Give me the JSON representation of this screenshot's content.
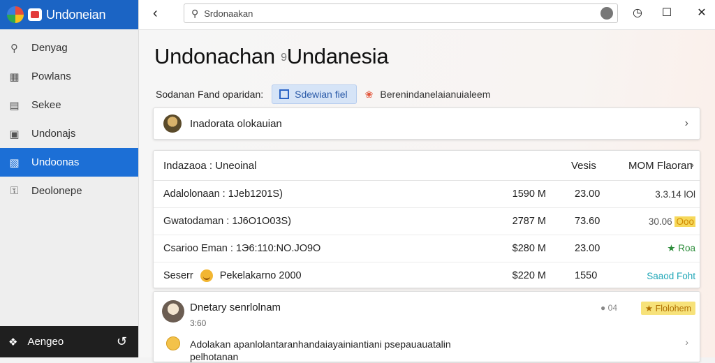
{
  "app": {
    "title": "Undonеian"
  },
  "sidebar": {
    "items": [
      {
        "label": "Denyag",
        "icon": "search-icon"
      },
      {
        "label": "Powlans",
        "icon": "grid-icon"
      },
      {
        "label": "Sekee",
        "icon": "panel-icon"
      },
      {
        "label": "Undonajs",
        "icon": "chart-icon"
      },
      {
        "label": "Undoonas",
        "icon": "calendar-icon",
        "active": true
      },
      {
        "label": "Deolonepe",
        "icon": "key-icon"
      }
    ],
    "footer": {
      "label": "Aengeo"
    }
  },
  "search": {
    "value": "Srdonaakan"
  },
  "main": {
    "title_left": "Undonachan",
    "title_sep": "9",
    "title_right": "Undanesia",
    "filter": {
      "label": "Sodanan Fand oparidan:",
      "primary_chip": "Sdewian fiel",
      "secondary_chip": "Berenindanelaianuialeem"
    },
    "account": {
      "label": "Inadorata olokauian"
    },
    "table": {
      "headers": {
        "name": "Indazaoa : Uneoinal",
        "col1": "Vesis",
        "col2": "MOM Flaoran"
      },
      "rows": [
        {
          "name": "Adalolonaan : 1Jeb1201S)",
          "value": "1590 M",
          "num": "23.00",
          "status": "3.3.14 lOl",
          "style": "plain"
        },
        {
          "name": "Gwatodaman : 1J6O1O03S)",
          "value": "2787 M",
          "num": "73.60",
          "status": "30.06",
          "badge": "Ooo",
          "style": "yellow"
        },
        {
          "name": "Csarioo Eman : 1Э6:110:NO.JO9O",
          "value": "$280 M",
          "num": "23.00",
          "status": "Roa",
          "style": "green"
        },
        {
          "name": "Seserr",
          "extra": "Pekelakarno 2000",
          "value": "$220 M",
          "num": "1550",
          "status": "Saaod Foht",
          "style": "teal"
        }
      ]
    },
    "activity": {
      "title": "Dnetary senrlolnam",
      "subtitle": "3:60",
      "meta": "04",
      "badge": "Flolohem",
      "text": "Adolakan apanlolantaranhandaiayainiantiani psepauauatalin pelhotanan"
    }
  },
  "colors": {
    "accent": "#1c6fd6",
    "brand": "#1b64c4"
  }
}
